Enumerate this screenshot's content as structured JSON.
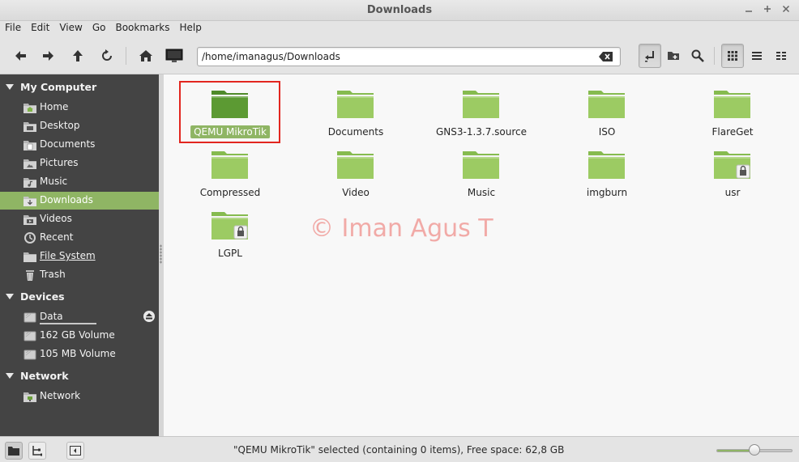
{
  "window": {
    "title": "Downloads"
  },
  "menu": [
    "File",
    "Edit",
    "View",
    "Go",
    "Bookmarks",
    "Help"
  ],
  "location": {
    "path": "/home/imanagus/Downloads"
  },
  "sidebar": {
    "sections": [
      {
        "title": "My Computer",
        "items": [
          {
            "label": "Home",
            "icon": "home-folder-icon"
          },
          {
            "label": "Desktop",
            "icon": "desktop-folder-icon"
          },
          {
            "label": "Documents",
            "icon": "documents-folder-icon"
          },
          {
            "label": "Pictures",
            "icon": "pictures-folder-icon"
          },
          {
            "label": "Music",
            "icon": "music-folder-icon"
          },
          {
            "label": "Downloads",
            "icon": "downloads-folder-icon",
            "selected": true
          },
          {
            "label": "Videos",
            "icon": "videos-folder-icon"
          },
          {
            "label": "Recent",
            "icon": "recent-icon"
          },
          {
            "label": "File System",
            "icon": "filesystem-icon"
          },
          {
            "label": "Trash",
            "icon": "trash-icon"
          }
        ]
      },
      {
        "title": "Devices",
        "items": [
          {
            "label": "Data",
            "icon": "drive-icon"
          },
          {
            "label": "162 GB Volume",
            "icon": "drive-icon"
          },
          {
            "label": "105 MB Volume",
            "icon": "drive-icon"
          }
        ]
      },
      {
        "title": "Network",
        "items": [
          {
            "label": "Network",
            "icon": "network-icon"
          }
        ]
      }
    ]
  },
  "files": [
    {
      "name": "QEMU MikroTik",
      "selected": true,
      "locked": false
    },
    {
      "name": "Documents",
      "locked": false
    },
    {
      "name": "GNS3-1.3.7.source",
      "locked": false
    },
    {
      "name": "ISO",
      "locked": false
    },
    {
      "name": "FlareGet",
      "locked": false
    },
    {
      "name": "Compressed",
      "locked": false
    },
    {
      "name": "Video",
      "locked": false
    },
    {
      "name": "Music",
      "locked": false
    },
    {
      "name": "imgburn",
      "locked": false
    },
    {
      "name": "usr",
      "locked": true
    },
    {
      "name": "LGPL",
      "locked": true
    }
  ],
  "watermark": "© Iman Agus T",
  "status": {
    "text": "\"QEMU MikroTik\" selected (containing 0 items), Free space: 62,8 GB",
    "zoom": 0.5
  },
  "colors": {
    "accent": "#8fb564",
    "sidebar_bg": "#444444",
    "folder": "#7fb247",
    "selection_outline": "#e2261f"
  }
}
